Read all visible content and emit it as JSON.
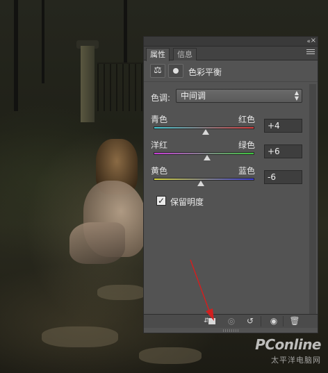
{
  "panel": {
    "tabs": [
      {
        "label": "属性",
        "active": true
      },
      {
        "label": "信息",
        "active": false
      }
    ],
    "adjustment_title": "色彩平衡",
    "tone": {
      "label": "色调:",
      "selected": "中间调"
    },
    "sliders": [
      {
        "left_label": "青色",
        "right_label": "红色",
        "value_text": "+4",
        "value": 4,
        "min": -100,
        "max": 100,
        "colors": [
          "#41c8d3",
          "#d83c3c"
        ]
      },
      {
        "left_label": "洋红",
        "right_label": "绿色",
        "value_text": "+6",
        "value": 6,
        "min": -100,
        "max": 100,
        "colors": [
          "#c83cd8",
          "#3cc83c"
        ]
      },
      {
        "left_label": "黄色",
        "right_label": "蓝色",
        "value_text": "-6",
        "value": -6,
        "min": -100,
        "max": 100,
        "colors": [
          "#d8d83c",
          "#3c3cd8"
        ]
      }
    ],
    "preserve_luminosity": {
      "label": "保留明度",
      "checked": true,
      "check_glyph": "✓"
    },
    "icons": {
      "collapse": "«",
      "close": "×",
      "adjustment": "⚖",
      "clip_arrow": "⇵",
      "view_previous": "◎",
      "reset": "↺",
      "visibility": "◉",
      "delete": "🗑"
    }
  },
  "annotation": {
    "arrow_color": "#d02020"
  },
  "watermark": {
    "logo": "PConline",
    "sub": "太平洋电脑网"
  }
}
